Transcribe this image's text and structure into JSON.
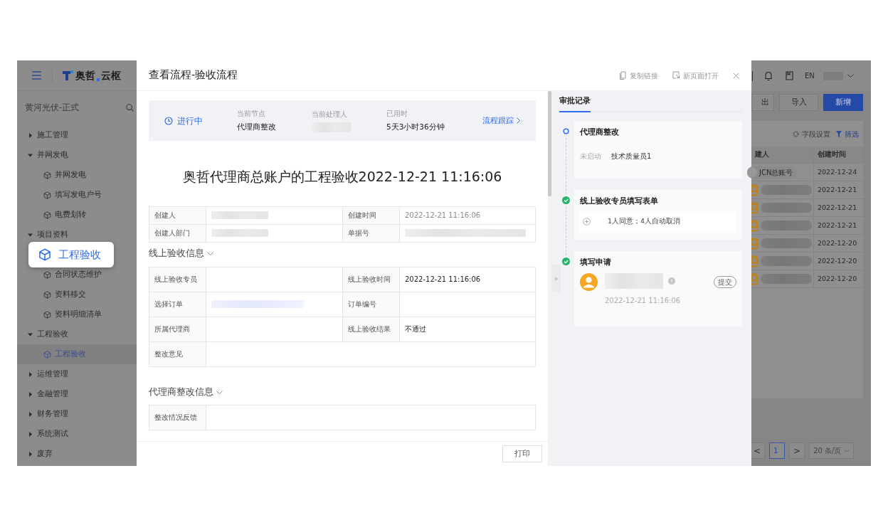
{
  "app": {
    "logo_brand": "奥哲",
    "logo_product": "云枢",
    "workspace": "黄河光伏-正式"
  },
  "sidebar": {
    "items": [
      {
        "label": "施工管理",
        "expanded": false
      },
      {
        "label": "并网发电",
        "expanded": true,
        "children": [
          {
            "label": "并网发电",
            "kind": "item",
            "selected": false
          },
          {
            "label": "填写发电户号",
            "kind": "item",
            "selected": false
          },
          {
            "label": "电费划转",
            "kind": "item",
            "selected": false
          }
        ]
      },
      {
        "label": "项目资料",
        "expanded": true,
        "children": [
          {
            "label": "工程验收",
            "kind": "callout",
            "selected": false
          },
          {
            "label": "合同状态维护",
            "kind": "item",
            "selected": false
          },
          {
            "label": "资料移交",
            "kind": "item",
            "selected": false
          },
          {
            "label": "资料明细清单",
            "kind": "item",
            "selected": false
          }
        ]
      },
      {
        "label": "工程验收",
        "expanded": true,
        "children": [
          {
            "label": "工程验收",
            "kind": "item",
            "selected": true
          }
        ]
      },
      {
        "label": "运维管理",
        "expanded": false
      },
      {
        "label": "金融管理",
        "expanded": false
      },
      {
        "label": "财务管理",
        "expanded": false
      },
      {
        "label": "系统测试",
        "expanded": false
      },
      {
        "label": "废弃",
        "expanded": false
      }
    ]
  },
  "background_page": {
    "language": "EN",
    "buttons": [
      {
        "label": "出",
        "kind": "default"
      },
      {
        "label": "导入",
        "kind": "default"
      },
      {
        "label": "新增",
        "kind": "primary"
      }
    ],
    "field_settings": "字段设置",
    "filter": "筛选",
    "table": {
      "columns": [
        "建人",
        "创建时间"
      ],
      "rows": [
        {
          "kind": "account",
          "creator": "JCN总账号",
          "created": "2022-12-24"
        },
        {
          "kind": "redacted",
          "created": "2022-12-21"
        },
        {
          "kind": "redacted",
          "created": "2022-12-21"
        },
        {
          "kind": "redacted",
          "created": "2022-12-21"
        },
        {
          "kind": "redacted",
          "created": "2022-12-20"
        },
        {
          "kind": "redacted",
          "created": "2022-12-20"
        },
        {
          "kind": "redacted",
          "created": "2022-12-20"
        }
      ]
    },
    "pagination": {
      "prev": "<",
      "pages": [
        {
          "label": "1",
          "selected": true
        }
      ],
      "next": ">",
      "page_size": "20 条/页"
    }
  },
  "dialog": {
    "title": "查看流程-验收流程",
    "actions": [
      "复制链接",
      "新页面打开"
    ],
    "status": {
      "state": "进行中",
      "fields": [
        {
          "label": "当前节点",
          "kind": "text",
          "value": "代理商整改"
        },
        {
          "label": "当前处理人",
          "kind": "redacted"
        },
        {
          "label": "已用时",
          "kind": "text",
          "value": "5天3小时36分钟"
        }
      ],
      "trace_link": "流程跟踪"
    },
    "form_title": "奥哲代理商总账户的工程验收2022-12-21 11:16:06",
    "sections": [
      {
        "fields": [
          {
            "label": "创建人",
            "kind": "redacted"
          },
          {
            "label": "创建时间",
            "kind": "muted",
            "value": "2022-12-21 11:16:06"
          },
          {
            "label": "创建人部门",
            "kind": "redacted"
          },
          {
            "label": "单据号",
            "kind": "redacted"
          }
        ]
      },
      {
        "heading": "线上验收信息",
        "fields": [
          {
            "label": "线上验收专员",
            "kind": "empty"
          },
          {
            "label": "线上验收时间",
            "kind": "text",
            "value": "2022-12-21 11:16:06"
          },
          {
            "label": "选择订单",
            "kind": "redacted-link"
          },
          {
            "label": "订单编号",
            "kind": "empty"
          },
          {
            "label": "所属代理商",
            "kind": "empty"
          },
          {
            "label": "线上验收结果",
            "kind": "text",
            "value": "不通过"
          },
          {
            "label": "整改意见",
            "kind": "wide"
          }
        ]
      },
      {
        "heading": "代理商整改信息",
        "fields": [
          {
            "label": "整改情况反馈",
            "kind": "wide"
          }
        ]
      }
    ],
    "print_button": "打印",
    "collapse_handle": "»",
    "approval": {
      "tabs": [
        {
          "label": "审批记录",
          "selected": true
        }
      ],
      "steps": [
        {
          "title": "代理商整改",
          "done": false,
          "kind": "pending",
          "state_label": "未启动",
          "handler": "技术质量员1"
        },
        {
          "title": "线上验收专员填写表单",
          "done": true,
          "kind": "summary",
          "summary": "1人同意；4人自动取消"
        },
        {
          "title": "填写申请",
          "done": true,
          "kind": "submitter",
          "action": "提交",
          "time": "2022-12-21 11:16:06"
        }
      ]
    }
  }
}
